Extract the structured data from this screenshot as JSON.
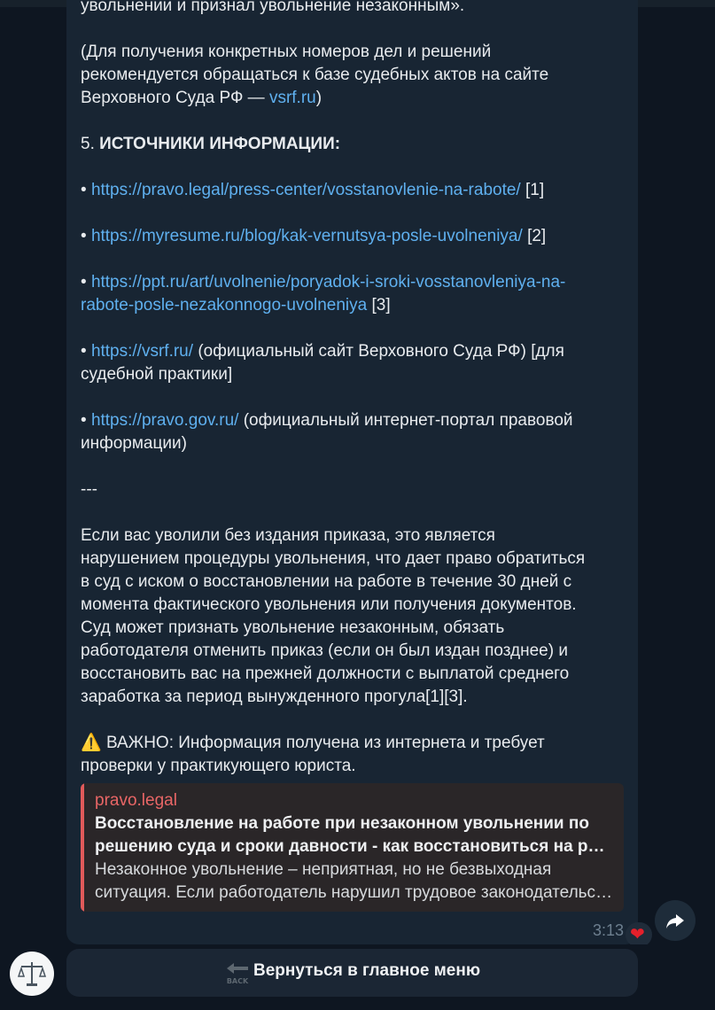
{
  "message": {
    "top_partial_line": "увольнении и признал увольнение незаконным».",
    "note_text_1": "(Для получения конкретных номеров дел и решений",
    "note_text_2": "рекомендуется обращаться к базе судебных актов на сайте",
    "note_text_3a": "Верховного Суда РФ — ",
    "note_link": "vsrf.ru",
    "note_text_3b": ")",
    "sources_number": "5. ",
    "sources_heading": "ИСТОЧНИКИ ИНФОРМАЦИИ:",
    "bullet": "•",
    "source1_url": "https://pravo.legal/press-center/vosstanovlenie-na-rabote/",
    "source1_ref": "[1]",
    "source2_url": "https://myresume.ru/blog/kak-vernutsya-posle-uvolneniya/",
    "source2_ref": "[2]",
    "source3_url_line1": "https://ppt.ru/art/uvolnenie/poryadok-i-sroki-vosstanovleniya-na-",
    "source3_url_line2": "rabote-posle-nezakonnogo-uvolneniya",
    "source3_ref": "[3]",
    "source4_url": "https://vsrf.ru/",
    "source4_desc": "(официальный сайт Верховного Суда РФ) [для",
    "source4_desc2": "судебной практики]",
    "source5_url": "https://pravo.gov.ru/",
    "source5_desc": "(официальный интернет-портал правовой",
    "source5_desc2": "информации)",
    "separator": "---",
    "summary_lines": [
      "Если вас уволили без издания приказа, это является",
      "нарушением процедуры увольнения, что дает право обратиться",
      "в суд с иском о восстановлении на работе в течение 30 дней с",
      "момента фактического увольнения или получения документов.",
      "Суд может признать увольнение незаконным, обязать",
      "работодателя отменить приказ (если он был издан позднее) и",
      "восстановить вас на прежней должности с выплатой среднего",
      "заработка за период вынужденного прогула[1][3]."
    ],
    "warning_icon": "⚠️",
    "warning_line1": " ВАЖНО: Информация получена из интернета и требует",
    "warning_line2": "проверки у практикующего юриста.",
    "time": "3:13"
  },
  "preview": {
    "site": "pravo.legal",
    "title_line1": "Восстановление на работе при незаконном увольнении по",
    "title_line2": "решению суда и сроки давности - как восстановиться на работе",
    "desc_line1": "Незаконное увольнение – неприятная, но не безвыходная",
    "desc_line2": "ситуация. Если работодатель нарушил трудовое законодательство"
  },
  "reaction": {
    "icon": "heart-icon",
    "glyph": "❤"
  },
  "keyboard": {
    "button_label": "Вернуться в главное меню",
    "button_icon": "back-arrow-icon"
  },
  "colors": {
    "background": "#0e1621",
    "bubble": "#182533",
    "link": "#5fb0ef",
    "preview_accent": "#e05a5a"
  }
}
